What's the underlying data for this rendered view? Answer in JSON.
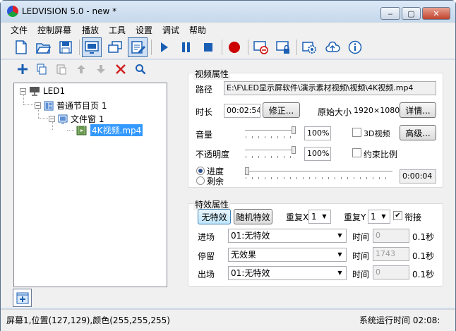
{
  "window": {
    "title": "LEDVISION 5.0 - new *",
    "controls": {
      "minimize": "‒",
      "maximize": "▢",
      "close": "✕"
    }
  },
  "menu": [
    "文件",
    "控制屏幕",
    "播放",
    "工具",
    "设置",
    "调试",
    "帮助"
  ],
  "toolbar": {
    "icons": [
      "new-file-icon",
      "open-folder-icon",
      "save-icon",
      "screen-settings-icon",
      "multi-window-icon",
      "edit-document-icon",
      "play-icon",
      "pause-icon",
      "stop-icon",
      "record-icon",
      "screen-off-icon",
      "lock-screen-icon",
      "settings-icon",
      "cloud-upload-icon",
      "info-icon"
    ],
    "selected": [
      "screen-settings-icon",
      "edit-document-icon"
    ]
  },
  "left_toolbar": [
    "add-icon",
    "copy-icon",
    "paste-icon",
    "move-up-icon",
    "move-down-icon",
    "delete-icon",
    "search-icon"
  ],
  "tree": {
    "screen": "LED1",
    "page": "普通节目页 1",
    "window": "文件窗 1",
    "file": "4K视频.mp4"
  },
  "video_props": {
    "group_title": "视频属性",
    "path_label": "路径",
    "path_value": "E:\\F\\LED显示屏软件\\演示素材视频\\视频\\4K视频.mp4",
    "duration_label": "时长",
    "duration_value": "00:02:54",
    "modify_btn": "修正...",
    "orig_size_label": "原始大小",
    "orig_size_value": "1920×1080",
    "details_btn": "详情...",
    "volume_label": "音量",
    "volume_value": "100%",
    "volume_level": 1.0,
    "video3d_label": "3D视频",
    "advanced_btn": "高级...",
    "opacity_label": "不透明度",
    "opacity_value": "100%",
    "opacity_level": 1.0,
    "constrain_label": "约束比例",
    "progress_label": "进度",
    "remain_label": "剩余",
    "progress_time": "0:00:04",
    "progress_level": 0.0
  },
  "effects": {
    "group_title": "特效属性",
    "no_effect_btn": "无特效",
    "random_btn": "随机特效",
    "repeat_x_label": "重复X",
    "repeat_x_value": "1",
    "repeat_y_label": "重复Y",
    "repeat_y_value": "1",
    "connect_label": "衔接",
    "connect_checked": true,
    "rows": [
      {
        "label": "进场",
        "effect": "01:无特效",
        "time_label": "时间",
        "time_value": "0",
        "unit": "0.1秒"
      },
      {
        "label": "停留",
        "effect": "无效果",
        "time_label": "时间",
        "time_value": "1743",
        "unit": "0.1秒"
      },
      {
        "label": "出场",
        "effect": "01:无特效",
        "time_label": "时间",
        "time_value": "0",
        "unit": "0.1秒"
      }
    ]
  },
  "status": {
    "left": "屏幕1,位置(127,129),颜色(255,255,255)",
    "right": "系统运行时间 02:08:"
  },
  "colors": {
    "accent": "#3399ff",
    "record": "#cc0000",
    "delete": "#d02020",
    "toolbar_blue": "#1a5fb4"
  }
}
